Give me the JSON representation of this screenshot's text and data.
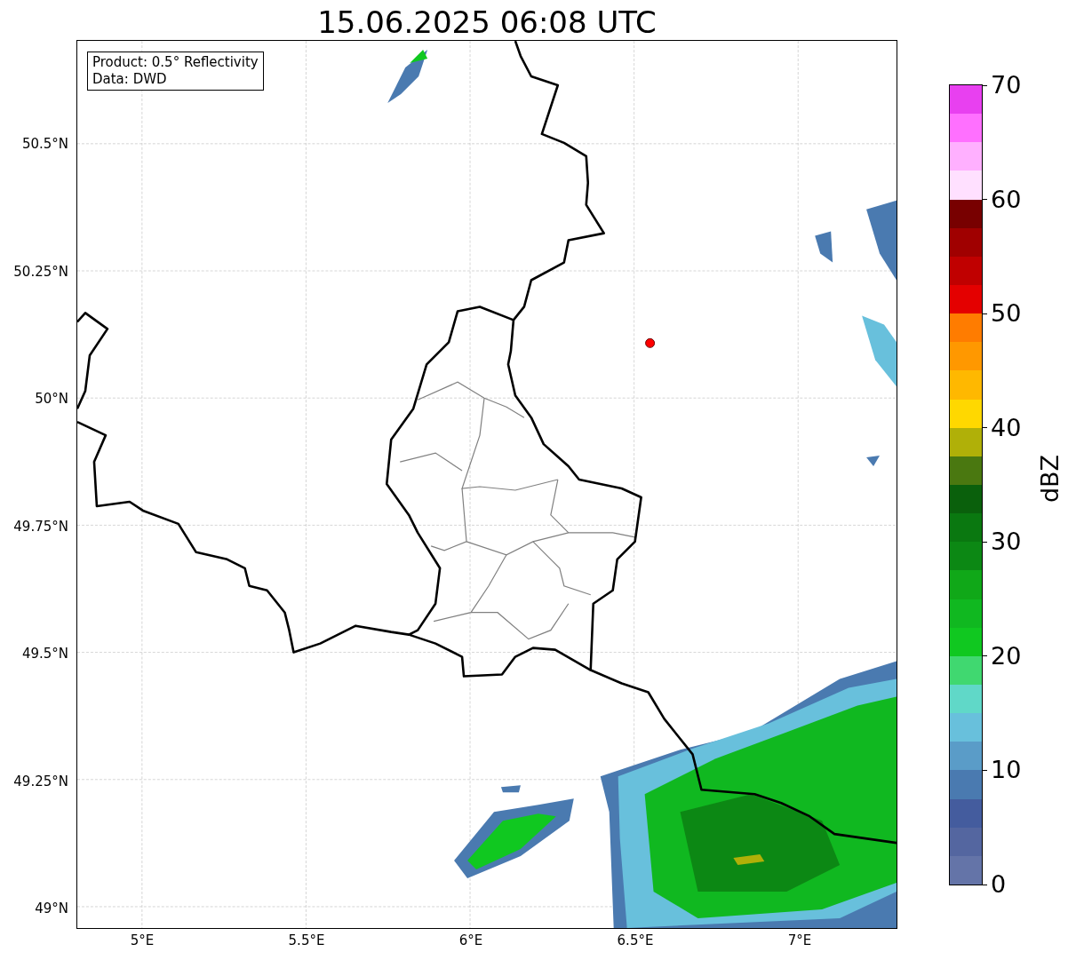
{
  "title": "15.06.2025 06:08 UTC",
  "map": {
    "legend": [
      "Product: 0.5° Reflectivity",
      "Data: DWD"
    ],
    "lat_ticks": [
      "50.5°N",
      "50.25°N",
      "50°N",
      "49.75°N",
      "49.5°N",
      "49.25°N",
      "49°N"
    ],
    "lon_ticks": [
      "5°E",
      "5.5°E",
      "6°E",
      "6.5°E",
      "7°E"
    ]
  },
  "colorbar": {
    "label": "dBZ",
    "ticks": [
      "70",
      "60",
      "50",
      "40",
      "30",
      "20",
      "10",
      "0"
    ],
    "segments": [
      {
        "color": "#6474a8"
      },
      {
        "color": "#5466a0"
      },
      {
        "color": "#445c9e"
      },
      {
        "color": "#4a7ab0"
      },
      {
        "color": "#5a9cc8"
      },
      {
        "color": "#68c0dc"
      },
      {
        "color": "#60d8c8"
      },
      {
        "color": "#40d870"
      },
      {
        "color": "#10c820"
      },
      {
        "color": "#10b820"
      },
      {
        "color": "#10a818"
      },
      {
        "color": "#0c8814"
      },
      {
        "color": "#0a7810"
      },
      {
        "color": "#0a600c"
      },
      {
        "color": "#4a7810"
      },
      {
        "color": "#b0b008"
      },
      {
        "color": "#ffd800"
      },
      {
        "color": "#ffb800"
      },
      {
        "color": "#ff9800"
      },
      {
        "color": "#ff7c00"
      },
      {
        "color": "#e40000"
      },
      {
        "color": "#c00000"
      },
      {
        "color": "#a00000"
      },
      {
        "color": "#780000"
      },
      {
        "color": "#ffe0ff"
      },
      {
        "color": "#ffb0ff"
      },
      {
        "color": "#ff70ff"
      },
      {
        "color": "#e840f0"
      }
    ]
  }
}
